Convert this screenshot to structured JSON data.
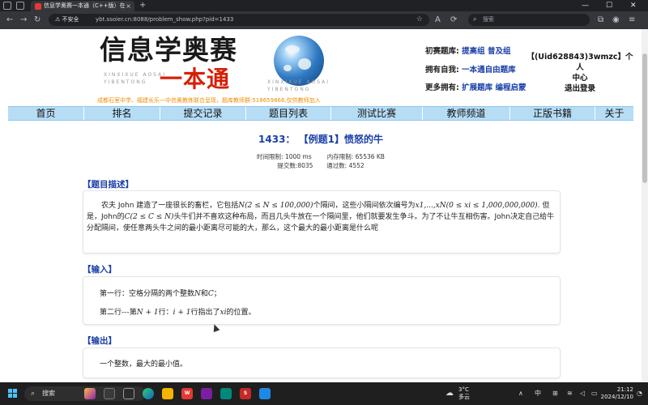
{
  "browser": {
    "tab_title": "信息学奥赛一本通（C++版）在线...",
    "tab_close": "×",
    "new_tab": "+",
    "not_secure": "⚠ 不安全",
    "url": "ybt.ssoier.cn:8088/problem_show.php?pid=1433",
    "search_placeholder": "搜索",
    "win_min": "—",
    "win_max": "☐",
    "win_close": "✕"
  },
  "site": {
    "logo_title": "信息学奥赛",
    "logo_subtitle": "一本通",
    "logo_pinyin_1": "XINXIXUE AOSAI",
    "logo_pinyin_2": "YIBENTONG",
    "logo_slogan": "成都石室中学、福建长乐一中信奥教练联合呈现，题库教师群:518659866,仅供教师加入",
    "bank_1_label": "初赛题库:",
    "bank_1_link_1": "提高组",
    "bank_1_link_2": "普及组",
    "bank_2_label": "拥有自我:",
    "bank_2_link": "一本通自由题库",
    "bank_3_label": "更多拥有:",
    "bank_3_link_1": "扩展题库",
    "bank_3_link_2": "编程启蒙",
    "user_line_1": "【(Uid628843)3wmzc】个人",
    "user_line_2": "中心",
    "user_line_3": "退出登录"
  },
  "nav": {
    "items": [
      "首页",
      "排名",
      "提交记录",
      "题目列表",
      "测试比赛",
      "教师频道",
      "正版书籍",
      "关于"
    ]
  },
  "problem": {
    "title": "1433： 【例题1】愤怒的牛",
    "time_limit": "时间限制: 1000 ms",
    "memory_limit": "内存限制: 65536 KB",
    "submissions": "提交数:8035",
    "accepted": "通过数: 4552",
    "desc_head": "【题目描述】",
    "desc_1": "农夫 John 建造了一座很长的畜栏，它包括",
    "desc_math_1": "N(2 ≤ N ≤ 100,000)",
    "desc_2": "个隔间，这些小隔间依次编号为",
    "desc_math_2": "x1,...,xN(0 ≤ xi ≤ 1,000,000,000)",
    "desc_3": ". 但是，John的",
    "desc_math_3": "C(2 ≤ C ≤ N)",
    "desc_4": "头牛们并不喜欢这种布局，而且几头牛放在一个隔间里，他们就要发生争斗。为了不让牛互相伤害。John决定自己给牛分配隔间，使任意两头牛之间的最小距离尽可能的大，那么，这个最大的最小距离是什么呢",
    "input_head": "【输入】",
    "input_1a": "第一行：空格分隔的两个整数",
    "input_1m1": "N",
    "input_1b": "和",
    "input_1m2": "C",
    "input_1c": "；",
    "input_2a": "第二行---第",
    "input_2m1": "N + 1",
    "input_2b": "行：",
    "input_2m2": "i + 1",
    "input_2c": "行指出了",
    "input_2m3": "xi",
    "input_2d": "的位置。",
    "output_head": "【输出】",
    "output_1": "一个整数，最大的最小值。"
  },
  "taskbar": {
    "search": "搜索",
    "weather_temp": "3°C",
    "weather_desc": "多云",
    "ime": "中",
    "time": "21:12",
    "date": "2024/12/10"
  }
}
